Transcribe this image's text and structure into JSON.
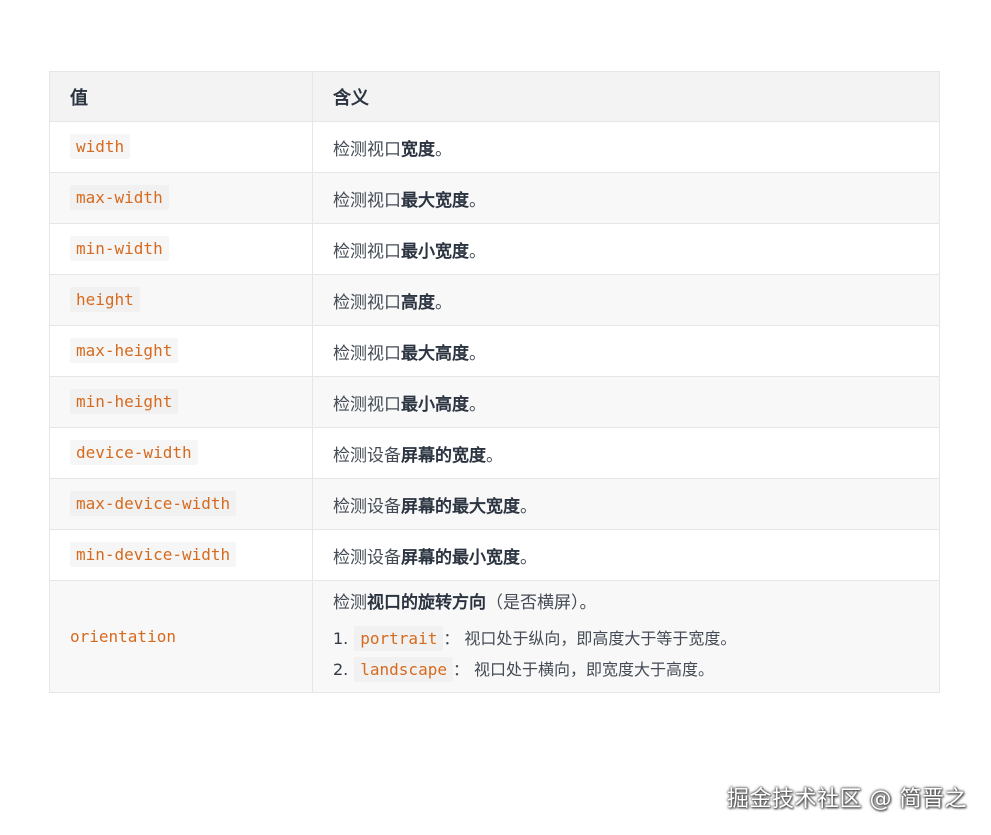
{
  "table": {
    "headers": [
      "值",
      "含义"
    ],
    "rows": [
      {
        "key": "width",
        "prefix": "检测视口",
        "bold": "宽度",
        "suffix": "。"
      },
      {
        "key": "max-width",
        "prefix": "检测视口",
        "bold": "最大宽度",
        "suffix": "。"
      },
      {
        "key": "min-width",
        "prefix": "检测视口",
        "bold": "最小宽度",
        "suffix": "。"
      },
      {
        "key": "height",
        "prefix": "检测视口",
        "bold": "高度",
        "suffix": "。"
      },
      {
        "key": "max-height",
        "prefix": "检测视口",
        "bold": "最大高度",
        "suffix": "。"
      },
      {
        "key": "min-height",
        "prefix": "检测视口",
        "bold": "最小高度",
        "suffix": "。"
      },
      {
        "key": "device-width",
        "prefix": "检测设备",
        "bold": "屏幕的宽度",
        "suffix": "。"
      },
      {
        "key": "max-device-width",
        "prefix": "检测设备",
        "bold": "屏幕的最大宽度",
        "suffix": "。"
      },
      {
        "key": "min-device-width",
        "prefix": "检测设备",
        "bold": "屏幕的最小宽度",
        "suffix": "。"
      }
    ],
    "orientation": {
      "key": "orientation",
      "prefix": "检测",
      "bold": "视口的旋转方向",
      "suffix": "（是否横屏）。",
      "items": [
        {
          "num": "1.",
          "code": "portrait",
          "text": "： 视口处于纵向，即高度大于等于宽度。"
        },
        {
          "num": "2.",
          "code": "landscape",
          "text": "： 视口处于横向，即宽度大于高度。"
        }
      ]
    }
  },
  "watermark": "掘金技术社区 @ 简晋之"
}
